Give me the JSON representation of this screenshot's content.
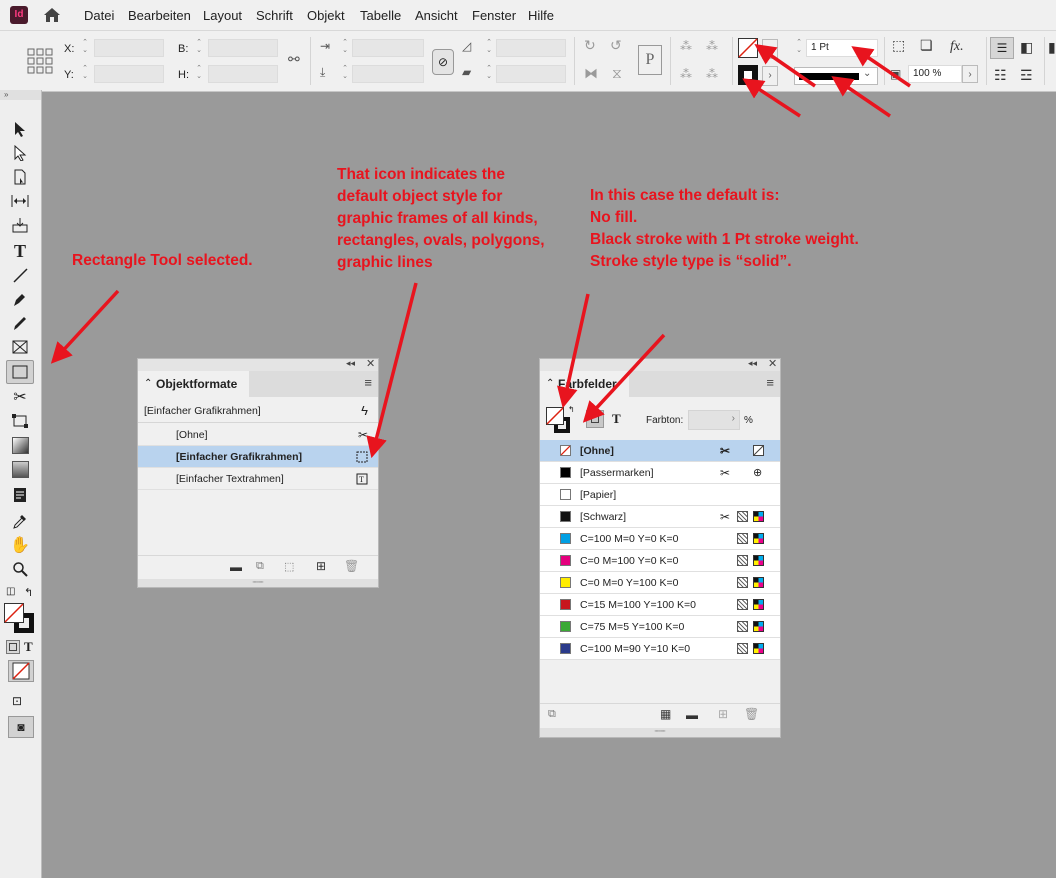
{
  "app": {
    "logo": "Id"
  },
  "menu": [
    "Datei",
    "Bearbeiten",
    "Layout",
    "Schrift",
    "Objekt",
    "Tabelle",
    "Ansicht",
    "Fenster",
    "Hilfe"
  ],
  "control": {
    "x_label": "X:",
    "y_label": "Y:",
    "w_label": "B:",
    "h_label": "H:",
    "stroke_weight": "1 Pt",
    "opacity": "100 %",
    "fx": "fx."
  },
  "objektformate": {
    "title": "Objektformate",
    "header_row": "[Einfacher Grafikrahmen]",
    "items": [
      "[Ohne]",
      "[Einfacher Grafikrahmen]",
      "[Einfacher Textrahmen]"
    ],
    "selected_index": 1
  },
  "farbfelder": {
    "title": "Farbfelder",
    "tint_label": "Farbton:",
    "tint_unit": "%",
    "swatches": [
      {
        "name": "[Ohne]",
        "color": "none",
        "selected": true
      },
      {
        "name": "[Passermarken]",
        "color": "#000000"
      },
      {
        "name": "[Papier]",
        "color": "#ffffff"
      },
      {
        "name": "[Schwarz]",
        "color": "#111111"
      },
      {
        "name": "C=100 M=0 Y=0 K=0",
        "color": "#009fe3"
      },
      {
        "name": "C=0 M=100 Y=0 K=0",
        "color": "#e5007e"
      },
      {
        "name": "C=0 M=0 Y=100 K=0",
        "color": "#ffed00"
      },
      {
        "name": "C=15 M=100 Y=100 K=0",
        "color": "#c8161d"
      },
      {
        "name": "C=75 M=5 Y=100 K=0",
        "color": "#3aa935"
      },
      {
        "name": "C=100 M=90 Y=10 K=0",
        "color": "#2a3a8a"
      }
    ]
  },
  "annotations": {
    "tool": "Rectangle Tool selected.",
    "icon": "That icon indicates the\ndefault object style for\ngraphic frames of all kinds,\nrectangles, ovals, polygons,\ngraphic lines",
    "default": "In this case the default is:\nNo fill.\nBlack stroke with 1 Pt stroke weight.\nStroke style type is “solid”."
  },
  "colors": {
    "annotation": "#e8141e",
    "selection": "#b9d3ee"
  }
}
